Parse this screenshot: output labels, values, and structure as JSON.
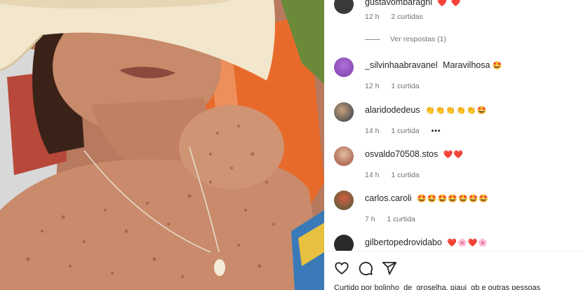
{
  "comments": [
    {
      "username": "gustavombaragni",
      "text": "",
      "emoji": "❤️ ❤️",
      "time": "12 h",
      "likes": "2 curtidas",
      "show_more": false,
      "avatar_color": "#3a3a3a"
    },
    {
      "username": "_silvinhaabravanel",
      "text": "Maravilhosa",
      "emoji": "🤩",
      "time": "12 h",
      "likes": "1 curtida",
      "show_more": false,
      "avatar_color": "#7a3fa8"
    },
    {
      "username": "alaridodedeus",
      "text": "",
      "emoji": "👏👏👏👏👏🤩",
      "time": "14 h",
      "likes": "1 curtida",
      "show_more": true,
      "avatar_color": "#2b3a4a"
    },
    {
      "username": "osvaldo70508.stos",
      "text": "",
      "emoji": "❤️❤️",
      "time": "14 h",
      "likes": "1 curtida",
      "show_more": false,
      "avatar_color": "#a04a3a"
    },
    {
      "username": "carlos.caroli",
      "text": "",
      "emoji": "🤩🤩🤩🤩🤩🤩🤩",
      "time": "7 h",
      "likes": "1 curtida",
      "show_more": false,
      "avatar_color": "#4a5a3a"
    },
    {
      "username": "gilbertopedrovidabo",
      "text": "",
      "emoji": "❤️🌸❤️🌸",
      "time": "",
      "likes": "",
      "show_more": false,
      "avatar_color": "#2a2a2a"
    }
  ],
  "replies_label": "Ver respostas (1)",
  "likes_summary": "Curtido por bolinho_de_groselha, piaui_gb e outras pessoas",
  "colors": {
    "text": "#262626",
    "muted": "#737373",
    "divider": "#efefef"
  },
  "icons": {
    "like": "heart-icon",
    "comment": "comment-icon",
    "share": "share-icon",
    "more": "more-options-icon"
  }
}
